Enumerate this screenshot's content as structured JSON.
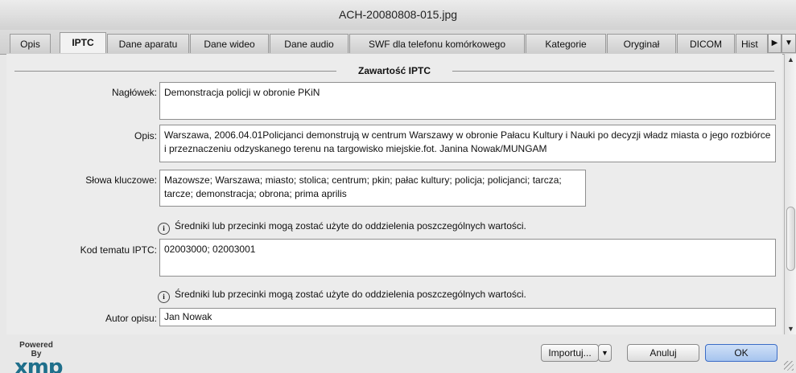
{
  "window": {
    "title": "ACH-20080808-015.jpg"
  },
  "tabs": [
    {
      "label": "Opis"
    },
    {
      "label": "IPTC"
    },
    {
      "label": "Dane aparatu"
    },
    {
      "label": "Dane wideo"
    },
    {
      "label": "Dane audio"
    },
    {
      "label": "SWF dla telefonu komórkowego"
    },
    {
      "label": "Kategorie"
    },
    {
      "label": "Oryginał"
    },
    {
      "label": "DICOM"
    },
    {
      "label": "Hist"
    }
  ],
  "tab_nav": {
    "next_icon": "triangle-right-icon",
    "menu_icon": "triangle-down-icon"
  },
  "section": {
    "title": "Zawartość IPTC"
  },
  "fields": {
    "headline": {
      "label": "Nagłówek:",
      "value": "Demonstracja policji w obronie PKiN"
    },
    "description": {
      "label": "Opis:",
      "value": "Warszawa, 2006.04.01Policjanci demonstrują w centrum Warszawy w obronie Pałacu Kultury i Nauki po decyzji władz miasta o jego rozbiórce i przeznaczeniu odzyskanego terenu na targowisko miejskie.fot. Janina Nowak/MUNGAM"
    },
    "keywords": {
      "label": "Słowa kluczowe:",
      "value": "Mazowsze; Warszawa; miasto; stolica; centrum; pkin; pałac kultury; policja; policjanci; tarcza; tarcze; demonstracja; obrona; prima aprilis"
    },
    "keywords_hint": "Średniki lub przecinki mogą zostać użyte do oddzielenia poszczególnych wartości.",
    "subject_code": {
      "label": "Kod tematu IPTC:",
      "value": "02003000; 02003001"
    },
    "subject_hint": "Średniki lub przecinki mogą zostać użyte do oddzielenia poszczególnych wartości.",
    "author": {
      "label": "Autor opisu:",
      "value": "Jan Nowak"
    }
  },
  "footer": {
    "powered_by": "Powered By",
    "logo": "xmp",
    "import_label": "Importuj...",
    "cancel_label": "Anuluj",
    "ok_label": "OK"
  }
}
